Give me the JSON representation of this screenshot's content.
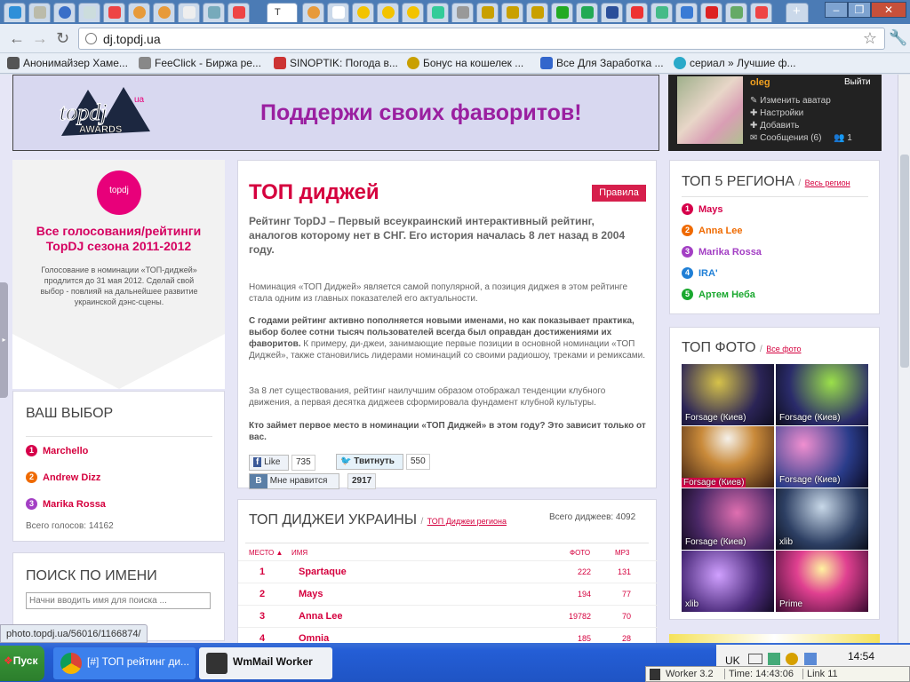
{
  "browser": {
    "active_tab_label": "T",
    "url": "dj.topdj.ua",
    "bookmarks": [
      "Анонимайзер Хаме...",
      "FeeClick - Биржа ре...",
      "SINOPTIK: Погода в...",
      "Бонус на кошелек ...",
      "Все Для Заработка ...",
      "сериал » Лучшие ф..."
    ],
    "status_url": "photo.topdj.ua/56016/1166874/"
  },
  "header": {
    "slogan": "Поддержи своих фаворитов!",
    "logo_text": "topdj.ua AWARDS"
  },
  "user_panel": {
    "name": "oleg",
    "exit": "Выйти",
    "links": [
      "Изменить аватар",
      "Настройки",
      "Добавить",
      "Сообщения (6)"
    ],
    "extra_count": "1"
  },
  "promo": {
    "badge": "topdj",
    "title": "Все голосования/рейтинги TopDJ сезона 2011-2012",
    "text": "Голосование в номинации «ТОП-диджей» продлится до 31 мая 2012. Сделай свой выбор - повлияй на дальнейшее развитие украинской дэнс-сцены."
  },
  "your_choice": {
    "title": "ВАШ ВЫБОР",
    "items": [
      "Marchello",
      "Andrew Dizz",
      "Marika Rossa"
    ],
    "total": "Всего голосов: 14162"
  },
  "search": {
    "title": "ПОИСК ПО ИМЕНИ",
    "placeholder": "Начни вводить имя для поиска ..."
  },
  "main": {
    "title": "ТОП диджей",
    "rules_button": "Правила",
    "lead": "Рейтинг TopDJ – Первый всеукраинский интерактивный рейтинг, аналогов которому нет в СНГ. Его история началась 8 лет назад в 2004 году.",
    "p1": "Номинация «ТОП Диджей» является самой популярной, а позиция диджея в этом рейтинге стала одним из главных показателей его актуальности.",
    "p2_bold": "С годами рейтинг активно пополняется новыми именами, но как показывает практика, выбор более сотни тысяч пользователей всегда был оправдан достижениями их фаворитов.",
    "p2_rest": " К примеру, ди-джеи, занимающие первые позиции в основной номинации «ТОП Диджей», также становились лидерами номинаций со своими радиошоу, треками и ремиксами.",
    "p3": "За 8 лет существования, рейтинг наилучшим образом отображал тенденции клубного движения, а первая десятка диджеев сформировала фундамент клубной культуры.",
    "p4": "Кто займет первое место в номинации «ТОП Диджей» в этом году? Это зависит только от вас.",
    "fb_like": "Like",
    "fb_count": "735",
    "tweet": "Твитнуть",
    "tweet_count": "550",
    "vk_like": "Мне нравится",
    "vk_count": "2917"
  },
  "top_ua": {
    "title": "ТОП ДИДЖЕИ УКРАИНЫ",
    "region_link": "ТОП Диджеи региона",
    "total": "Всего диджеев: 4092",
    "columns": {
      "place": "МЕСТО",
      "name": "ИМЯ",
      "photo": "ФОТО",
      "mp3": "MP3"
    },
    "rows": [
      {
        "rank": "1",
        "name": "Spartaque",
        "photo": "222",
        "mp3": "131"
      },
      {
        "rank": "2",
        "name": "Mays",
        "photo": "194",
        "mp3": "77"
      },
      {
        "rank": "3",
        "name": "Anna Lee",
        "photo": "19782",
        "mp3": "70"
      },
      {
        "rank": "4",
        "name": "Omnia",
        "photo": "185",
        "mp3": "28"
      }
    ]
  },
  "top5": {
    "title": "ТОП 5 РЕГИОНА",
    "link": "Весь регион",
    "items": [
      {
        "name": "Mays",
        "color": "#d6004a"
      },
      {
        "name": "Anna Lee",
        "color": "#ef6a00"
      },
      {
        "name": "Marika Rossa",
        "color": "#a33fc4"
      },
      {
        "name": "IRA'",
        "color": "#1f7fd6"
      },
      {
        "name": "Артем Неба",
        "color": "#1aa82f"
      }
    ]
  },
  "top_photo": {
    "title": "ТОП ФОТО",
    "link": "Все фото",
    "captions": [
      "Forsage (Киев)",
      "Forsage (Киев)",
      "Forsage (Киев)",
      "Forsage (Киев)",
      "Forsage (Киев)",
      "xlib",
      "xlib",
      "Prime"
    ]
  },
  "taskbar": {
    "start": "Пуск",
    "task1": "[#] ТОП рейтинг ди...",
    "task2": "WmMail Worker",
    "lang": "UK",
    "clock": "14:54",
    "worker": "Worker 3.2",
    "time": "Time: 14:43:06",
    "link": "Link 11"
  }
}
